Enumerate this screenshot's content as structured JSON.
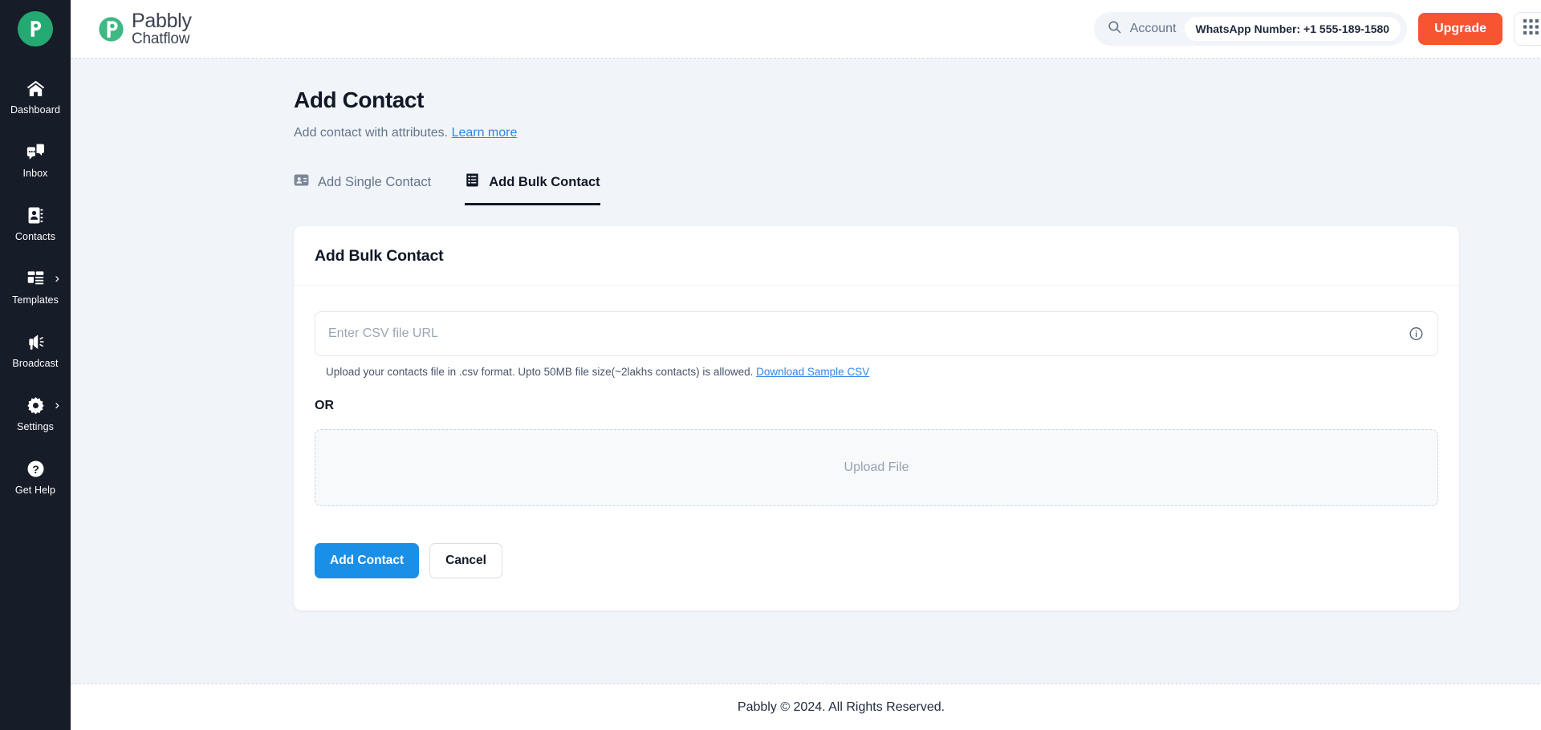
{
  "sidebar": {
    "logo_icon": "pabbly-p-logo-icon",
    "items": [
      {
        "label": "Dashboard",
        "icon": "home-icon",
        "chevron": false
      },
      {
        "label": "Inbox",
        "icon": "chat-bubble-icon",
        "chevron": false
      },
      {
        "label": "Contacts",
        "icon": "address-book-icon",
        "chevron": false
      },
      {
        "label": "Templates",
        "icon": "template-layout-icon",
        "chevron": true,
        "chevron_glyph": "›"
      },
      {
        "label": "Broadcast",
        "icon": "megaphone-icon",
        "chevron": false
      },
      {
        "label": "Settings",
        "icon": "gear-icon",
        "chevron": true,
        "chevron_glyph": "›"
      },
      {
        "label": "Get Help",
        "icon": "question-circle-icon",
        "chevron": false
      }
    ]
  },
  "header": {
    "brand_icon": "pabbly-logo-icon",
    "brand_name": "Pabbly",
    "brand_sub": "Chatflow",
    "search_icon": "search-icon",
    "account_label": "Account",
    "whatsapp_number": "WhatsApp Number: +1 555-189-1580",
    "upgrade_label": "Upgrade",
    "apps_icon": "grid-apps-icon",
    "avatar_icon": "power-user-avatar-icon",
    "upgrade_color": "#f75431"
  },
  "page": {
    "title": "Add Contact",
    "subtitle": "Add contact with attributes.",
    "learn_more": "Learn more",
    "tabs": [
      {
        "label": "Add Single Contact",
        "icon": "contact-card-icon",
        "active": false
      },
      {
        "label": "Add Bulk Contact",
        "icon": "bulk-list-icon",
        "active": true
      }
    ]
  },
  "card": {
    "title": "Add Bulk Contact",
    "csv_input": {
      "placeholder": "Enter CSV file URL",
      "value": "",
      "info_icon": "info-circle-icon"
    },
    "helper_text": "Upload your contacts file in .csv format. Upto 50MB file size(~2lakhs contacts) is allowed.",
    "helper_link": "Download Sample CSV",
    "or_label": "OR",
    "dropzone_label": "Upload File",
    "primary_button": "Add Contact",
    "secondary_button": "Cancel",
    "primary_color": "#1a8fe8"
  },
  "footer": {
    "text": "Pabbly © 2024. All Rights Reserved."
  }
}
